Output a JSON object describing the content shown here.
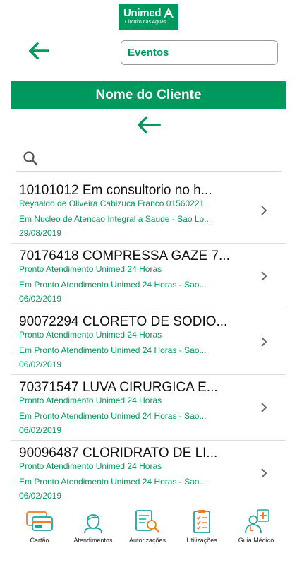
{
  "header": {
    "logo_brand": "Unimed",
    "logo_sub": "Circuito das Aguas",
    "select_value": "Eventos"
  },
  "client_bar": {
    "label": "Nome do Cliente"
  },
  "search": {
    "icon": "search-icon"
  },
  "items": [
    {
      "title": "10101012  Em consultorio  no h...",
      "line1": "Reynaldo de Oliveira Cabizuca Franco   01560221",
      "line2": "Em Nucleo de Atencao Integral a Saude - Sao Lo...",
      "date": "29/08/2019"
    },
    {
      "title": "70176418  COMPRESSA GAZE 7...",
      "line1": "Pronto Atendimento Unimed 24 Horas",
      "line2": "Em Pronto Atendimento Unimed 24 Horas - Sao...",
      "date": "06/02/2019"
    },
    {
      "title": "90072294  CLORETO DE SODIO...",
      "line1": "Pronto Atendimento Unimed 24 Horas",
      "line2": "Em Pronto Atendimento Unimed 24 Horas - Sao...",
      "date": "06/02/2019"
    },
    {
      "title": "70371547  LUVA CIRURGICA E...",
      "line1": "Pronto Atendimento Unimed 24 Horas",
      "line2": "Em Pronto Atendimento Unimed 24 Horas - Sao...",
      "date": "06/02/2019"
    },
    {
      "title": "90096487  CLORIDRATO DE LI...",
      "line1": "Pronto Atendimento Unimed 24 Horas",
      "line2": "Em Pronto Atendimento Unimed 24 Horas - Sao...",
      "date": "06/02/2019"
    }
  ],
  "tabs": [
    {
      "label": "Cartão",
      "icon": "card-icon"
    },
    {
      "label": "Atendimentos",
      "icon": "person-icon"
    },
    {
      "label": "Autorizações",
      "icon": "document-search-icon"
    },
    {
      "label": "Utilizações",
      "icon": "clipboard-icon"
    },
    {
      "label": "Guia Médico",
      "icon": "doctor-icon"
    }
  ],
  "colors": {
    "brand_green": "#00995d",
    "accent_orange": "#f47c20",
    "accent_teal": "#1aa7a0"
  }
}
